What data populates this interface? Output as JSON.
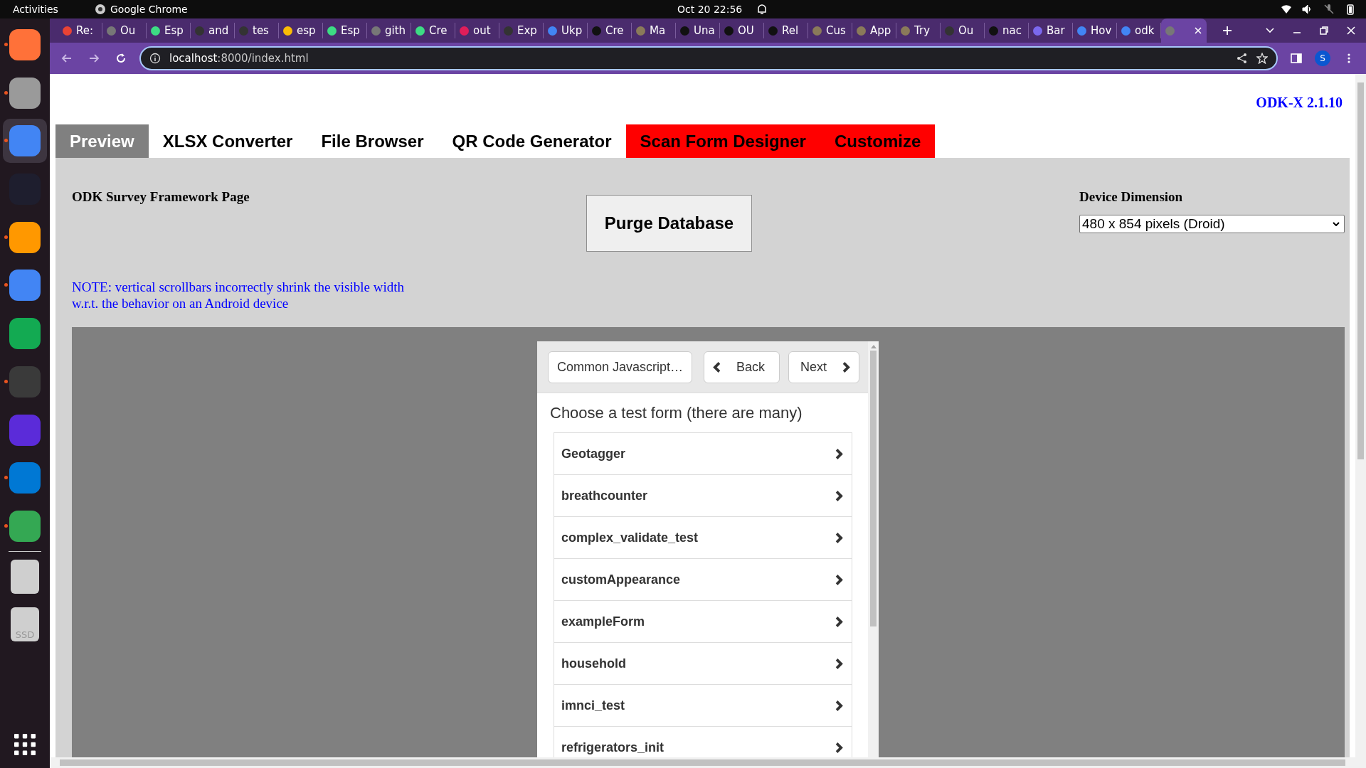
{
  "top_bar": {
    "activities": "Activities",
    "app": "Google Chrome",
    "clock": "Oct 20  22:56"
  },
  "dock": {
    "items": [
      {
        "kind": "app",
        "color": "#ff7139",
        "running": true,
        "selected": false
      },
      {
        "kind": "app",
        "color": "#9a9a9a",
        "running": true,
        "selected": false
      },
      {
        "kind": "app",
        "color": "#4285f4",
        "running": true,
        "selected": true
      },
      {
        "kind": "app",
        "color": "#1e1e2e",
        "running": false,
        "selected": false
      },
      {
        "kind": "app",
        "color": "#ff9800",
        "running": true,
        "selected": false
      },
      {
        "kind": "app",
        "color": "#4285f4",
        "running": true,
        "selected": false
      },
      {
        "kind": "app",
        "color": "#13aa52",
        "running": false,
        "selected": false
      },
      {
        "kind": "app",
        "color": "#3a3a3a",
        "running": true,
        "selected": false
      },
      {
        "kind": "app",
        "color": "#5b2bd9",
        "running": false,
        "selected": false
      },
      {
        "kind": "app",
        "color": "#0078d4",
        "running": true,
        "selected": false
      },
      {
        "kind": "app",
        "color": "#34a853",
        "running": true,
        "selected": false
      },
      {
        "kind": "drive",
        "color": "#cfcfcf",
        "running": false,
        "selected": false
      },
      {
        "kind": "drive",
        "color": "#cfcfcf",
        "running": false,
        "selected": false,
        "label": "SSD"
      }
    ]
  },
  "browser": {
    "tabs": [
      {
        "title": "Re:",
        "color": "#ea4335",
        "selected": false
      },
      {
        "title": "Ou",
        "color": "#777777",
        "selected": false
      },
      {
        "title": "Esp",
        "color": "#3ddc84",
        "selected": false
      },
      {
        "title": "and",
        "color": "#333333",
        "selected": false
      },
      {
        "title": "tes",
        "color": "#333333",
        "selected": false
      },
      {
        "title": "esp",
        "color": "#fbbc05",
        "selected": false
      },
      {
        "title": "Esp",
        "color": "#3ddc84",
        "selected": false
      },
      {
        "title": "gith",
        "color": "#777777",
        "selected": false
      },
      {
        "title": "Cre",
        "color": "#3ddc84",
        "selected": false
      },
      {
        "title": "out",
        "color": "#e01e5a",
        "selected": false
      },
      {
        "title": "Exp",
        "color": "#333333",
        "selected": false
      },
      {
        "title": "Ukp",
        "color": "#4285f4",
        "selected": false
      },
      {
        "title": "Cre",
        "color": "#111111",
        "selected": false
      },
      {
        "title": "Ma",
        "color": "#8a7a5a",
        "selected": false
      },
      {
        "title": "Una",
        "color": "#111111",
        "selected": false
      },
      {
        "title": "OU",
        "color": "#111111",
        "selected": false
      },
      {
        "title": "Rel",
        "color": "#111111",
        "selected": false
      },
      {
        "title": "Cus",
        "color": "#8a7a5a",
        "selected": false
      },
      {
        "title": "App",
        "color": "#8a7a5a",
        "selected": false
      },
      {
        "title": "Try",
        "color": "#8a7a5a",
        "selected": false
      },
      {
        "title": "Ou",
        "color": "#333333",
        "selected": false
      },
      {
        "title": "nac",
        "color": "#111111",
        "selected": false
      },
      {
        "title": "Bar",
        "color": "#7b68ee",
        "selected": false
      },
      {
        "title": "Hov",
        "color": "#4285f4",
        "selected": false
      },
      {
        "title": "odk",
        "color": "#4285f4",
        "selected": false
      },
      {
        "color": "#777777",
        "selected": true
      }
    ],
    "url_host": "localhost",
    "url_path": ":8000/index.html",
    "profile_initial": "S"
  },
  "page": {
    "version": "ODK-X 2.1.10",
    "tabs": [
      {
        "label": "Preview",
        "selected": true,
        "color": "#808080"
      },
      {
        "label": "XLSX Converter",
        "selected": false,
        "color": "#ffffff"
      },
      {
        "label": "File Browser",
        "selected": false,
        "color": "#ffffff"
      },
      {
        "label": "QR Code Generator",
        "selected": false,
        "color": "#ffffff"
      },
      {
        "label": "Scan Form Designer",
        "selected": false,
        "color": "#ff0000"
      },
      {
        "label": "Customize",
        "selected": false,
        "color": "#ff0000"
      }
    ],
    "framework_title": "ODK Survey Framework Page",
    "purge_button": "Purge Database",
    "device_dimension": {
      "label": "Device Dimension",
      "value": "480 x 854 pixels (Droid)"
    },
    "note": "NOTE: vertical scrollbars incorrectly shrink the visible width w.r.t. the behavior on an Android device",
    "preview": {
      "menu_button": "Common Javascript…",
      "back_button": "Back",
      "next_button": "Next",
      "heading": "Choose a test form (there are many)",
      "forms": [
        "Geotagger",
        "breathcounter",
        "complex_validate_test",
        "customAppearance",
        "exampleForm",
        "household",
        "imnci_test",
        "refrigerators_init"
      ]
    }
  }
}
